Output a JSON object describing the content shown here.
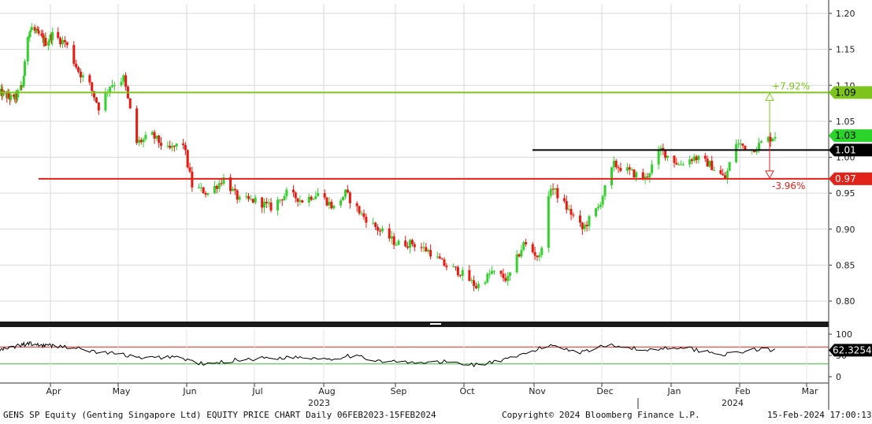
{
  "chart_data": [
    {
      "type": "candlestick",
      "title": "GENS SP Equity (Genting Singapore Ltd) EQUITY PRICE CHART",
      "period": "Daily 06FEB2023-15FEB2024",
      "ylim": [
        0.76,
        1.21
      ],
      "yticks": [
        0.8,
        0.85,
        0.9,
        0.95,
        1.0,
        1.05,
        1.1,
        1.15,
        1.2
      ],
      "ytick_labels": [
        "0.80",
        "0.85",
        "0.90",
        "0.95",
        "1.00",
        "1.05",
        "1.10",
        "1.15",
        "1.20"
      ],
      "x_months": [
        "Apr",
        "May",
        "Jun",
        "Jul",
        "Aug",
        "Sep",
        "Oct",
        "Nov",
        "Dec",
        "Jan",
        "Feb",
        "Mar"
      ],
      "x_years": [
        "2023",
        "2024"
      ],
      "close_series": [
        {
          "date": "2023-02-06",
          "close": 1.09
        },
        {
          "date": "2023-02-20",
          "close": 1.08
        },
        {
          "date": "2023-03-01",
          "close": 1.1
        },
        {
          "date": "2023-03-06",
          "close": 1.17
        },
        {
          "date": "2023-03-10",
          "close": 1.18
        },
        {
          "date": "2023-03-17",
          "close": 1.17
        },
        {
          "date": "2023-03-24",
          "close": 1.16
        },
        {
          "date": "2023-03-31",
          "close": 1.17
        },
        {
          "date": "2023-04-06",
          "close": 1.16
        },
        {
          "date": "2023-04-12",
          "close": 1.12
        },
        {
          "date": "2023-04-17",
          "close": 1.1
        },
        {
          "date": "2023-04-21",
          "close": 1.07
        },
        {
          "date": "2023-04-26",
          "close": 1.1
        },
        {
          "date": "2023-05-02",
          "close": 1.11
        },
        {
          "date": "2023-05-04",
          "close": 1.08
        },
        {
          "date": "2023-05-08",
          "close": 1.02
        },
        {
          "date": "2023-05-15",
          "close": 1.03
        },
        {
          "date": "2023-05-22",
          "close": 1.01
        },
        {
          "date": "2023-05-29",
          "close": 1.02
        },
        {
          "date": "2023-06-02",
          "close": 0.96
        },
        {
          "date": "2023-06-09",
          "close": 0.95
        },
        {
          "date": "2023-06-16",
          "close": 0.97
        },
        {
          "date": "2023-06-23",
          "close": 0.94
        },
        {
          "date": "2023-06-30",
          "close": 0.94
        },
        {
          "date": "2023-07-07",
          "close": 0.93
        },
        {
          "date": "2023-07-14",
          "close": 0.95
        },
        {
          "date": "2023-07-21",
          "close": 0.94
        },
        {
          "date": "2023-07-28",
          "close": 0.95
        },
        {
          "date": "2023-08-04",
          "close": 0.93
        },
        {
          "date": "2023-08-09",
          "close": 0.95
        },
        {
          "date": "2023-08-16",
          "close": 0.92
        },
        {
          "date": "2023-08-23",
          "close": 0.9
        },
        {
          "date": "2023-08-31",
          "close": 0.88
        },
        {
          "date": "2023-09-07",
          "close": 0.88
        },
        {
          "date": "2023-09-14",
          "close": 0.87
        },
        {
          "date": "2023-09-21",
          "close": 0.85
        },
        {
          "date": "2023-09-28",
          "close": 0.84
        },
        {
          "date": "2023-10-05",
          "close": 0.82
        },
        {
          "date": "2023-10-12",
          "close": 0.84
        },
        {
          "date": "2023-10-19",
          "close": 0.83
        },
        {
          "date": "2023-10-26",
          "close": 0.88
        },
        {
          "date": "2023-11-02",
          "close": 0.86
        },
        {
          "date": "2023-11-07",
          "close": 0.96
        },
        {
          "date": "2023-11-14",
          "close": 0.93
        },
        {
          "date": "2023-11-21",
          "close": 0.9
        },
        {
          "date": "2023-11-28",
          "close": 0.93
        },
        {
          "date": "2023-12-05",
          "close": 0.99
        },
        {
          "date": "2023-12-12",
          "close": 0.98
        },
        {
          "date": "2023-12-19",
          "close": 0.97
        },
        {
          "date": "2023-12-26",
          "close": 1.01
        },
        {
          "date": "2024-01-03",
          "close": 0.99
        },
        {
          "date": "2024-01-10",
          "close": 1.0
        },
        {
          "date": "2024-01-17",
          "close": 0.99
        },
        {
          "date": "2024-01-24",
          "close": 0.97
        },
        {
          "date": "2024-01-29",
          "close": 1.02
        },
        {
          "date": "2024-02-05",
          "close": 1.01
        },
        {
          "date": "2024-02-09",
          "close": 1.02
        },
        {
          "date": "2024-02-15",
          "close": 1.03
        }
      ],
      "levels": [
        {
          "value": 1.09,
          "label": "1.09",
          "color": "#7dc51e"
        },
        {
          "value": 1.01,
          "label": "1.01",
          "color": "#000000"
        },
        {
          "value": 0.97,
          "label": "0.97",
          "color": "#e2231a"
        }
      ],
      "last_price": {
        "value": 1.03,
        "label": "1.03",
        "color": "#2bd42b"
      },
      "annotations": [
        {
          "text": "+7.92%",
          "color": "#7dc51e"
        },
        {
          "text": "-3.96%",
          "color": "#e2231a"
        }
      ]
    },
    {
      "type": "line",
      "series_name": "RSI",
      "ylim": [
        0,
        100
      ],
      "yticks": [
        0,
        50,
        100
      ],
      "ytick_labels": [
        "0",
        "50",
        "100"
      ],
      "upper_level": 70,
      "lower_level": 30,
      "last_value": {
        "value": 62.3254,
        "label": "62.3254"
      },
      "series": [
        {
          "date": "2023-02-06",
          "value": 62
        },
        {
          "date": "2023-03-06",
          "value": 78
        },
        {
          "date": "2023-03-20",
          "value": 74
        },
        {
          "date": "2023-04-05",
          "value": 72
        },
        {
          "date": "2023-04-20",
          "value": 58
        },
        {
          "date": "2023-05-02",
          "value": 52
        },
        {
          "date": "2023-05-10",
          "value": 42
        },
        {
          "date": "2023-05-25",
          "value": 48
        },
        {
          "date": "2023-06-08",
          "value": 28
        },
        {
          "date": "2023-06-22",
          "value": 40
        },
        {
          "date": "2023-07-06",
          "value": 44
        },
        {
          "date": "2023-07-20",
          "value": 46
        },
        {
          "date": "2023-08-03",
          "value": 42
        },
        {
          "date": "2023-08-10",
          "value": 50
        },
        {
          "date": "2023-08-24",
          "value": 38
        },
        {
          "date": "2023-09-07",
          "value": 32
        },
        {
          "date": "2023-09-21",
          "value": 35
        },
        {
          "date": "2023-10-05",
          "value": 28
        },
        {
          "date": "2023-10-19",
          "value": 40
        },
        {
          "date": "2023-10-31",
          "value": 62
        },
        {
          "date": "2023-11-07",
          "value": 75
        },
        {
          "date": "2023-11-20",
          "value": 58
        },
        {
          "date": "2023-12-04",
          "value": 76
        },
        {
          "date": "2023-12-18",
          "value": 62
        },
        {
          "date": "2024-01-03",
          "value": 70
        },
        {
          "date": "2024-01-17",
          "value": 58
        },
        {
          "date": "2024-01-26",
          "value": 52
        },
        {
          "date": "2024-02-05",
          "value": 64
        },
        {
          "date": "2024-02-15",
          "value": 62
        }
      ]
    }
  ],
  "footer": {
    "left": "GENS SP Equity (Genting Singapore Ltd) EQUITY PRICE CHART  Daily 06FEB2023-15FEB2024",
    "center": "Copyright© 2024 Bloomberg Finance L.P.",
    "right": "15-Feb-2024 17:00:13"
  }
}
